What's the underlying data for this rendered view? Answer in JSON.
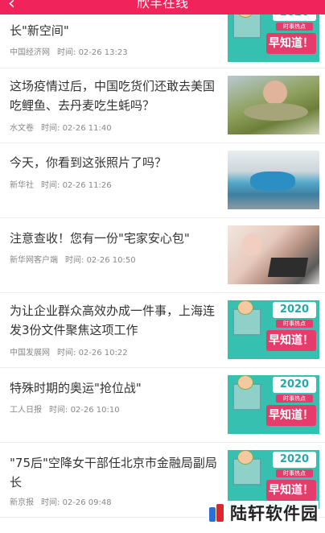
{
  "header": {
    "title": "欣丰在线",
    "back_icon": "‹"
  },
  "articles": [
    {
      "title": "长\"新空间\"",
      "source": "中国经济网",
      "time_label": "时间:",
      "time": "02-26 13:23",
      "thumb": "promo"
    },
    {
      "title": "这场疫情过后，中国吃货们还敢去美国吃鲤鱼、去丹麦吃生蚝吗？",
      "source": "水文卷",
      "time_label": "时间:",
      "time": "02-26 11:40",
      "thumb": "photo1"
    },
    {
      "title": "今天，你看到这张照片了吗？",
      "source": "新华社",
      "time_label": "时间:",
      "time": "02-26 11:26",
      "thumb": "photo2"
    },
    {
      "title": "注意查收！您有一份\"宅家安心包\"",
      "source": "新华网客户端",
      "time_label": "时间:",
      "time": "02-26 10:50",
      "thumb": "photo3"
    },
    {
      "title": "为让企业群众高效办成一件事，上海连发3份文件聚焦这项工作",
      "source": "中国发展网",
      "time_label": "时间:",
      "time": "02-26 10:22",
      "thumb": "promo"
    },
    {
      "title": "特殊时期的奥运\"抢位战\"",
      "source": "工人日报",
      "time_label": "时间:",
      "time": "02-26 10:10",
      "thumb": "promo"
    },
    {
      "title": "\"75后\"空降女干部任北京市金融局副局长",
      "source": "新京报",
      "time_label": "时间:",
      "time": "02-26 09:48",
      "thumb": "promo"
    }
  ],
  "promo": {
    "year": "2020",
    "subtitle": "时事热点",
    "main": "早知道！"
  },
  "watermark": {
    "text": "陆轩软件园"
  }
}
